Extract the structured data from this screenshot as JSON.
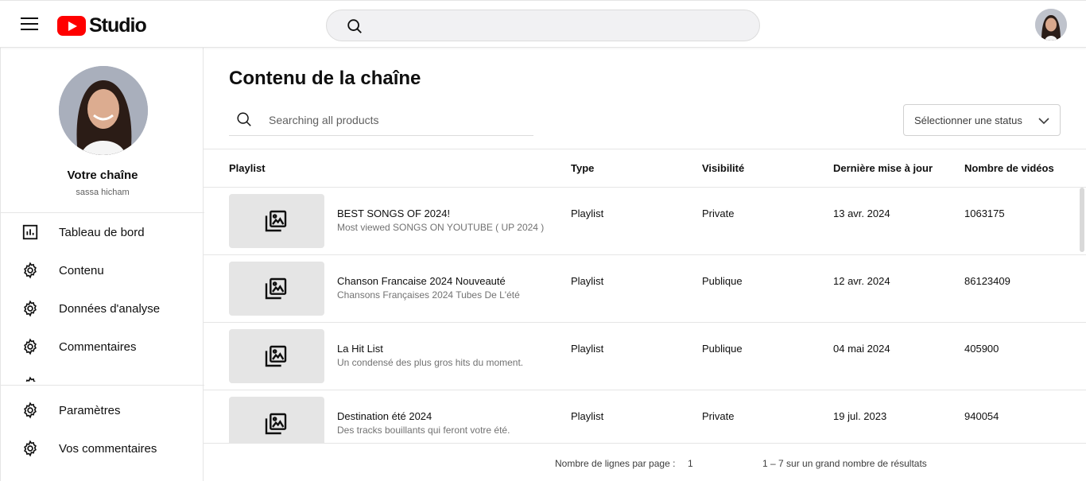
{
  "header": {
    "logo_text": "Studio",
    "search_placeholder": ""
  },
  "sidebar": {
    "channel_title": "Votre chaîne",
    "channel_user": "sassa hicham",
    "items": [
      {
        "label": "Tableau de bord",
        "icon": "analytics-icon"
      },
      {
        "label": "Contenu",
        "icon": "gear-icon"
      },
      {
        "label": "Données d'analyse",
        "icon": "gear-icon"
      },
      {
        "label": "Commentaires",
        "icon": "gear-icon"
      }
    ],
    "bottom_items": [
      {
        "label": "Paramètres",
        "icon": "gear-icon"
      },
      {
        "label": "Vos commentaires",
        "icon": "gear-icon"
      }
    ]
  },
  "main": {
    "title": "Contenu de la chaîne",
    "search_placeholder": "Searching all products",
    "status_select": "Sélectionner une status",
    "columns": [
      "Playlist",
      "Type",
      "Visibilité",
      "Dernière mise à jour",
      "Nombre de vidéos"
    ],
    "rows": [
      {
        "title": "BEST SONGS OF 2024!",
        "description": "Most viewed SONGS ON YOUTUBE ( UP 2024 )",
        "type": "Playlist",
        "visibility": "Private",
        "updated": "13 avr. 2024",
        "count": "1063175"
      },
      {
        "title": "Chanson Francaise 2024 Nouveauté",
        "description": "Chansons Françaises 2024 Tubes De L'été",
        "type": "Playlist",
        "visibility": "Publique",
        "updated": "12 avr. 2024",
        "count": "86123409"
      },
      {
        "title": "La Hit List",
        "description": "Un condensé des plus gros hits du moment.",
        "type": "Playlist",
        "visibility": "Publique",
        "updated": "04 mai 2024",
        "count": "405900"
      },
      {
        "title": "Destination été 2024",
        "description": "Des tracks bouillants qui feront votre été.",
        "type": "Playlist",
        "visibility": "Private",
        "updated": "19 jul. 2023",
        "count": "940054"
      }
    ],
    "footer": {
      "rows_per_page_label": "Nombre de lignes par page :",
      "rows_per_page_value": "1",
      "range_text": "1 – 7 sur un grand nombre de résultats"
    }
  },
  "colors": {
    "brand_red": "#ff0000",
    "thumb_bg": "#e5e5e5",
    "divider": "#e5e5e5"
  }
}
